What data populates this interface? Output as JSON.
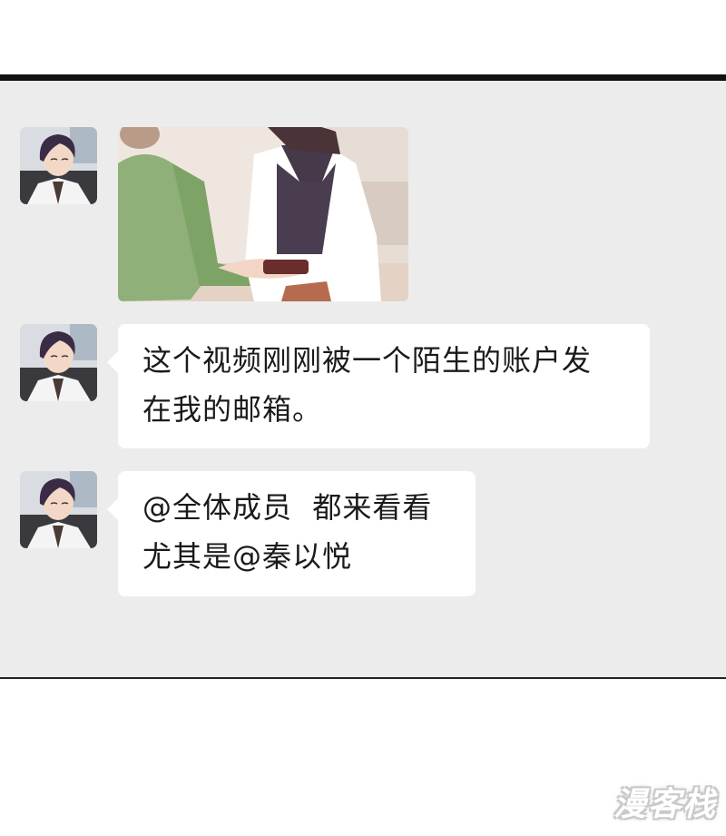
{
  "messages": [
    {
      "type": "image",
      "avatar": "user-avatar-doctor",
      "image": "photo-doctor-handing-item"
    },
    {
      "type": "text",
      "avatar": "user-avatar-doctor",
      "lines": [
        "这个视频刚刚被一个陌生的账户发",
        "在我的邮箱。"
      ]
    },
    {
      "type": "text",
      "avatar": "user-avatar-doctor",
      "lines": [
        "@全体成员  都来看看",
        "尤其是@秦以悦"
      ]
    }
  ],
  "watermark": "漫客栈",
  "colors": {
    "panel": "#ececec",
    "bubble": "#ffffff",
    "text": "#1a1a1a",
    "top_rule": "#111111"
  }
}
